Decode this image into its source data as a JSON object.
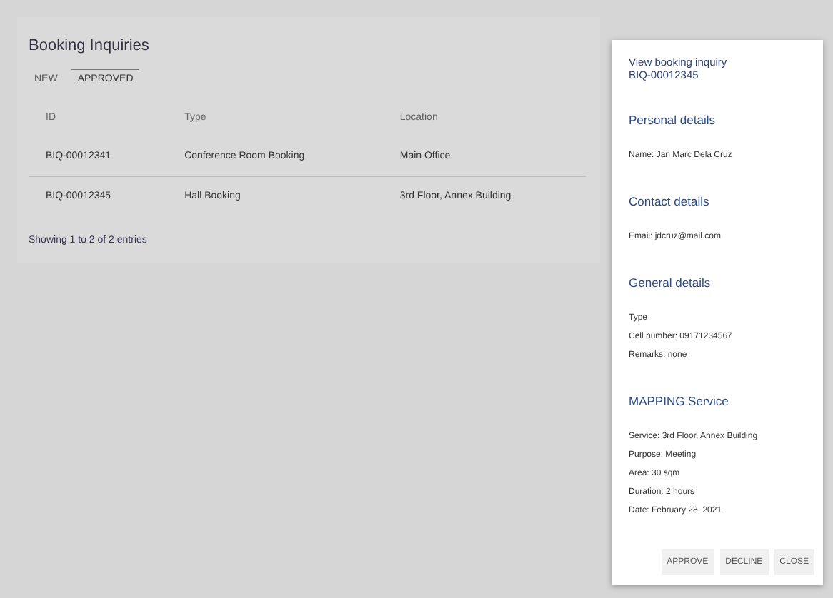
{
  "page": {
    "title": "Booking Inquiries"
  },
  "tabs": [
    {
      "label": "NEW",
      "selected": false
    },
    {
      "label": "APPROVED",
      "selected": true
    }
  ],
  "table": {
    "columns": [
      "ID",
      "Type",
      "Location"
    ],
    "rows": [
      [
        "BIQ-00012341",
        "Conference Room Booking",
        "Main Office"
      ],
      [
        "BIQ-00012345",
        "Hall Booking",
        "3rd Floor, Annex Building"
      ]
    ]
  },
  "footer": "Showing 1 to 2 of 2 entries",
  "dialog": {
    "title": [
      "View booking inquiry",
      "BIQ-00012345"
    ],
    "sections": [
      {
        "heading": "Personal details",
        "lines": [
          "Name: Jan Marc Dela Cruz"
        ]
      },
      {
        "heading": "Contact details",
        "lines": [
          "Email: jdcruz@mail.com"
        ]
      },
      {
        "heading": "General details",
        "lines": [
          "Type",
          "Cell number: 09171234567",
          "Remarks: none"
        ]
      },
      {
        "heading": "MAPPING Service",
        "lines": [
          "Service: 3rd Floor, Annex Building",
          "Purpose: Meeting",
          "Area: 30 sqm",
          "Duration: 2 hours",
          "Date: February 28, 2021"
        ]
      }
    ],
    "buttons": [
      "APPROVE",
      "DECLINE",
      "CLOSE"
    ]
  }
}
